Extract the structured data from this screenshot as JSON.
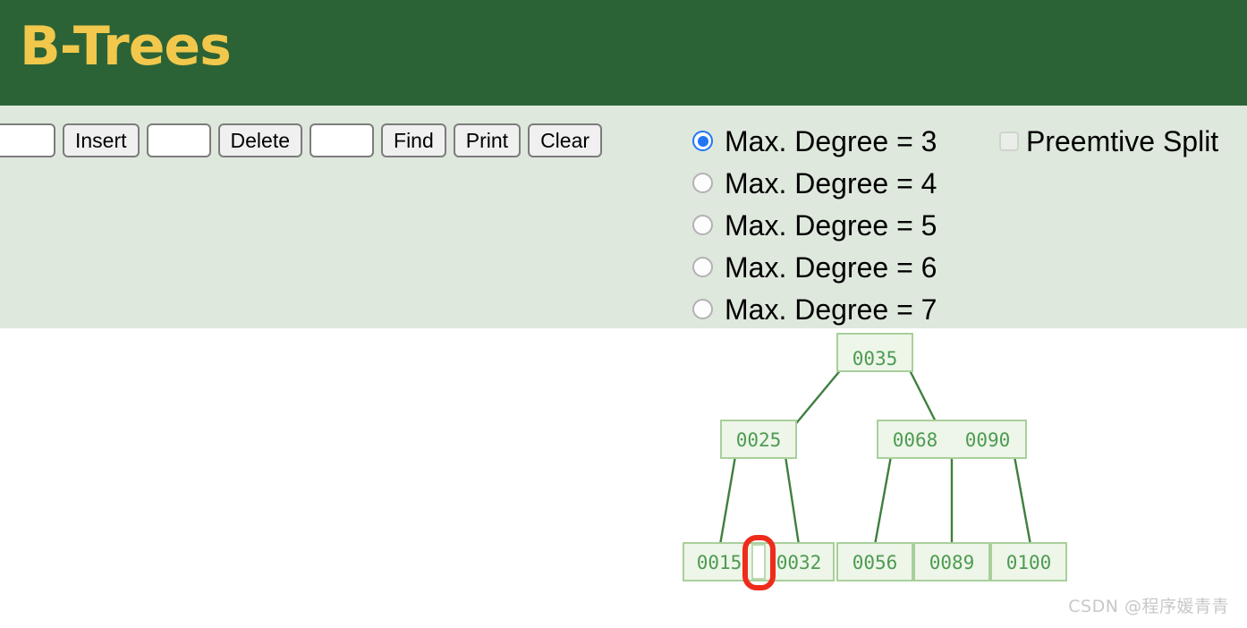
{
  "header": {
    "title": "B-Trees",
    "bg_color": "#2c6336",
    "title_color": "#f1c84c"
  },
  "control_panel": {
    "bg_color": "#dfe8dd"
  },
  "toolbar": {
    "insert_value": "",
    "insert_placeholder": "",
    "insert_label": "Insert",
    "delete_value": "",
    "delete_placeholder": "",
    "delete_label": "Delete",
    "find_value": "",
    "find_placeholder": "",
    "find_label": "Find",
    "print_label": "Print",
    "clear_label": "Clear"
  },
  "degree_options": [
    {
      "label": "Max. Degree = 3",
      "value": "3",
      "selected": true
    },
    {
      "label": "Max. Degree = 4",
      "value": "4",
      "selected": false
    },
    {
      "label": "Max. Degree = 5",
      "value": "5",
      "selected": false
    },
    {
      "label": "Max. Degree = 6",
      "value": "6",
      "selected": false
    },
    {
      "label": "Max. Degree = 7",
      "value": "7",
      "selected": false
    }
  ],
  "preemptive_split": {
    "label": "Preemtive Split",
    "checked": false
  },
  "tree": {
    "node_fill": "#edf6e9",
    "node_stroke": "#a9cf9c",
    "text_color": "#4e9a52",
    "edge_color": "#3f7f3f",
    "highlight_color": "#ef2b1b",
    "root": {
      "keys": [
        "0035"
      ]
    },
    "level2": [
      {
        "keys": [
          "0025"
        ]
      },
      {
        "keys": [
          "0068",
          "0090"
        ]
      }
    ],
    "leaves": [
      {
        "keys": [
          "0015",
          "",
          "0032"
        ],
        "highlight_index": 1
      },
      {
        "keys": [
          "0056"
        ]
      },
      {
        "keys": [
          "0089"
        ]
      },
      {
        "keys": [
          "0100"
        ]
      }
    ]
  },
  "watermark": {
    "text": "CSDN @程序媛青青"
  }
}
